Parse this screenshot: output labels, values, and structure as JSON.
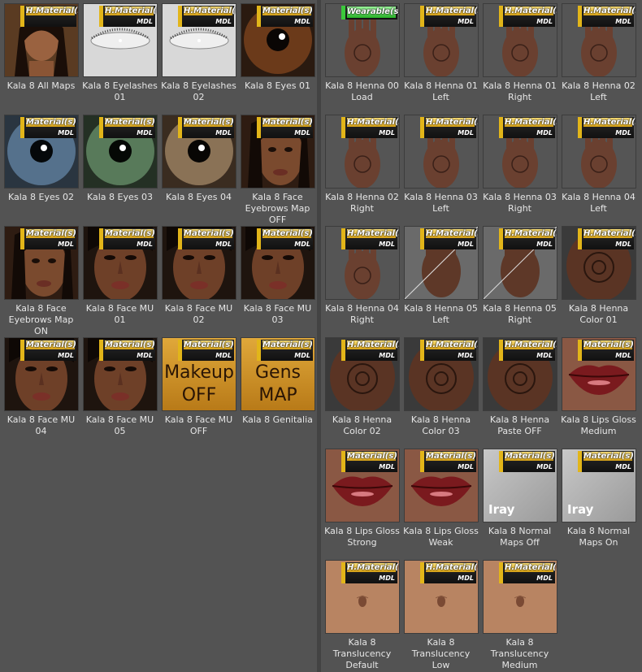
{
  "colors": {
    "badge_gold": "#e2b519",
    "badge_green": "#3bc93b",
    "panel_bg": "#535353",
    "caption_text": "#e6e6e6"
  },
  "left_tiles": [
    {
      "label": "Kala 8 All Maps",
      "badge": "H.Material(s)",
      "badge_sub": "",
      "badge_style": "gold",
      "thumb": "portrait"
    },
    {
      "label": "Kala 8 Eyelashes 01",
      "badge": "H.Material(s)",
      "badge_sub": "MDL",
      "badge_style": "gold",
      "thumb": "lashes"
    },
    {
      "label": "Kala 8 Eyelashes 02",
      "badge": "H.Material(s)",
      "badge_sub": "MDL",
      "badge_style": "gold",
      "thumb": "lashes"
    },
    {
      "label": "Kala 8 Eyes 01",
      "badge": "Material(s)",
      "badge_sub": "MDL",
      "badge_style": "gold",
      "thumb": "eye-brown"
    },
    {
      "label": "Kala 8 Eyes 02",
      "badge": "Material(s)",
      "badge_sub": "MDL",
      "badge_style": "gold",
      "thumb": "eye-blue"
    },
    {
      "label": "Kala 8 Eyes 03",
      "badge": "Material(s)",
      "badge_sub": "MDL",
      "badge_style": "gold",
      "thumb": "eye-green"
    },
    {
      "label": "Kala 8 Eyes 04",
      "badge": "Material(s)",
      "badge_sub": "MDL",
      "badge_style": "gold",
      "thumb": "eye-hazel"
    },
    {
      "label": "Kala 8 Face Eyebrows Map OFF",
      "badge": "Material(s)",
      "badge_sub": "MDL",
      "badge_style": "gold",
      "thumb": "face-dark"
    },
    {
      "label": "Kala 8 Face Eyebrows Map ON",
      "badge": "Material(s)",
      "badge_sub": "MDL",
      "badge_style": "gold",
      "thumb": "face-dark"
    },
    {
      "label": "Kala 8 Face MU 01",
      "badge": "Material(s)",
      "badge_sub": "MDL",
      "badge_style": "gold",
      "thumb": "face"
    },
    {
      "label": "Kala 8 Face MU 02",
      "badge": "Material(s)",
      "badge_sub": "MDL",
      "badge_style": "gold",
      "thumb": "face"
    },
    {
      "label": "Kala 8 Face MU 03",
      "badge": "Material(s)",
      "badge_sub": "MDL",
      "badge_style": "gold",
      "thumb": "face"
    },
    {
      "label": "Kala 8 Face MU 04",
      "badge": "Material(s)",
      "badge_sub": "MDL",
      "badge_style": "gold",
      "thumb": "face"
    },
    {
      "label": "Kala 8 Face MU 05",
      "badge": "Material(s)",
      "badge_sub": "MDL",
      "badge_style": "gold",
      "thumb": "face"
    },
    {
      "label": "Kala 8 Face MU OFF",
      "badge": "Material(s)",
      "badge_sub": "MDL",
      "badge_style": "gold",
      "thumb": "text-gold",
      "thumb_text": [
        "Makeup",
        "OFF"
      ]
    },
    {
      "label": "Kala 8 Genitalia",
      "badge": "Material(s)",
      "badge_sub": "MDL",
      "badge_style": "gold",
      "thumb": "text-gold",
      "thumb_text": [
        "Gens",
        "MAP"
      ]
    }
  ],
  "right_tiles": [
    {
      "label": "Kala 8 Henna 00 Load",
      "badge": "Wearable(s)",
      "badge_sub": "",
      "badge_style": "green",
      "thumb": "hand"
    },
    {
      "label": "Kala 8 Henna 01 Left",
      "badge": "H.Material(s)",
      "badge_sub": "MDL",
      "badge_style": "gold",
      "thumb": "hand"
    },
    {
      "label": "Kala 8 Henna 01 Right",
      "badge": "H.Material(s)",
      "badge_sub": "MDL",
      "badge_style": "gold",
      "thumb": "hand"
    },
    {
      "label": "Kala 8 Henna 02 Left",
      "badge": "H.Material(s)",
      "badge_sub": "MDL",
      "badge_style": "gold",
      "thumb": "hand"
    },
    {
      "label": "Kala 8 Henna 02 Right",
      "badge": "H.Material(s)",
      "badge_sub": "MDL",
      "badge_style": "gold",
      "thumb": "hand"
    },
    {
      "label": "Kala 8 Henna 03 Left",
      "badge": "H.Material(s)",
      "badge_sub": "MDL",
      "badge_style": "gold",
      "thumb": "hand"
    },
    {
      "label": "Kala 8 Henna 03 Right",
      "badge": "H.Material(s)",
      "badge_sub": "MDL",
      "badge_style": "gold",
      "thumb": "hand"
    },
    {
      "label": "Kala 8 Henna 04 Left",
      "badge": "H.Material(s)",
      "badge_sub": "MDL",
      "badge_style": "gold",
      "thumb": "hand"
    },
    {
      "label": "Kala 8 Henna 04 Right",
      "badge": "H.Material(s)",
      "badge_sub": "MDL",
      "badge_style": "gold",
      "thumb": "hand"
    },
    {
      "label": "Kala 8 Henna 05 Left",
      "badge": "H.Material(s)",
      "badge_sub": "MDL",
      "badge_style": "gold",
      "thumb": "hand-split"
    },
    {
      "label": "Kala 8 Henna 05 Right",
      "badge": "H.Material(s)",
      "badge_sub": "MDL",
      "badge_style": "gold",
      "thumb": "hand-split"
    },
    {
      "label": "Kala 8 Henna Color 01",
      "badge": "H.Material(s)",
      "badge_sub": "MDL",
      "badge_style": "gold",
      "thumb": "hand-close"
    },
    {
      "label": "Kala 8 Henna Color 02",
      "badge": "H.Material(s)",
      "badge_sub": "MDL",
      "badge_style": "gold",
      "thumb": "hand-close"
    },
    {
      "label": "Kala 8 Henna Color 03",
      "badge": "H.Material(s)",
      "badge_sub": "MDL",
      "badge_style": "gold",
      "thumb": "hand-close"
    },
    {
      "label": "Kala 8 Henna Paste OFF",
      "badge": "H.Material(s)",
      "badge_sub": "MDL",
      "badge_style": "gold",
      "thumb": "hand-close"
    },
    {
      "label": "Kala 8 Lips Gloss Medium",
      "badge": "Material(s)",
      "badge_sub": "MDL",
      "badge_style": "gold",
      "thumb": "lips"
    },
    {
      "label": "Kala 8 Lips Gloss Strong",
      "badge": "Material(s)",
      "badge_sub": "MDL",
      "badge_style": "gold",
      "thumb": "lips"
    },
    {
      "label": "Kala 8 Lips Gloss Weak",
      "badge": "Material(s)",
      "badge_sub": "MDL",
      "badge_style": "gold",
      "thumb": "lips"
    },
    {
      "label": "Kala 8 Normal Maps Off",
      "badge": "Material(s)",
      "badge_sub": "MDL",
      "badge_style": "gold",
      "thumb": "iray",
      "thumb_text": [
        "Iray"
      ]
    },
    {
      "label": "Kala 8 Normal Maps On",
      "badge": "Material(s)",
      "badge_sub": "MDL",
      "badge_style": "gold",
      "thumb": "iray",
      "thumb_text": [
        "Iray"
      ]
    },
    {
      "label": "Kala 8 Translucency Default",
      "badge": "H.Material(s)",
      "badge_sub": "MDL",
      "badge_style": "gold",
      "thumb": "belly"
    },
    {
      "label": "Kala 8 Translucency Low",
      "badge": "H.Material(s)",
      "badge_sub": "MDL",
      "badge_style": "gold",
      "thumb": "belly"
    },
    {
      "label": "Kala 8 Translucency Medium",
      "badge": "H.Material(s)",
      "badge_sub": "MDL",
      "badge_style": "gold",
      "thumb": "belly"
    }
  ]
}
